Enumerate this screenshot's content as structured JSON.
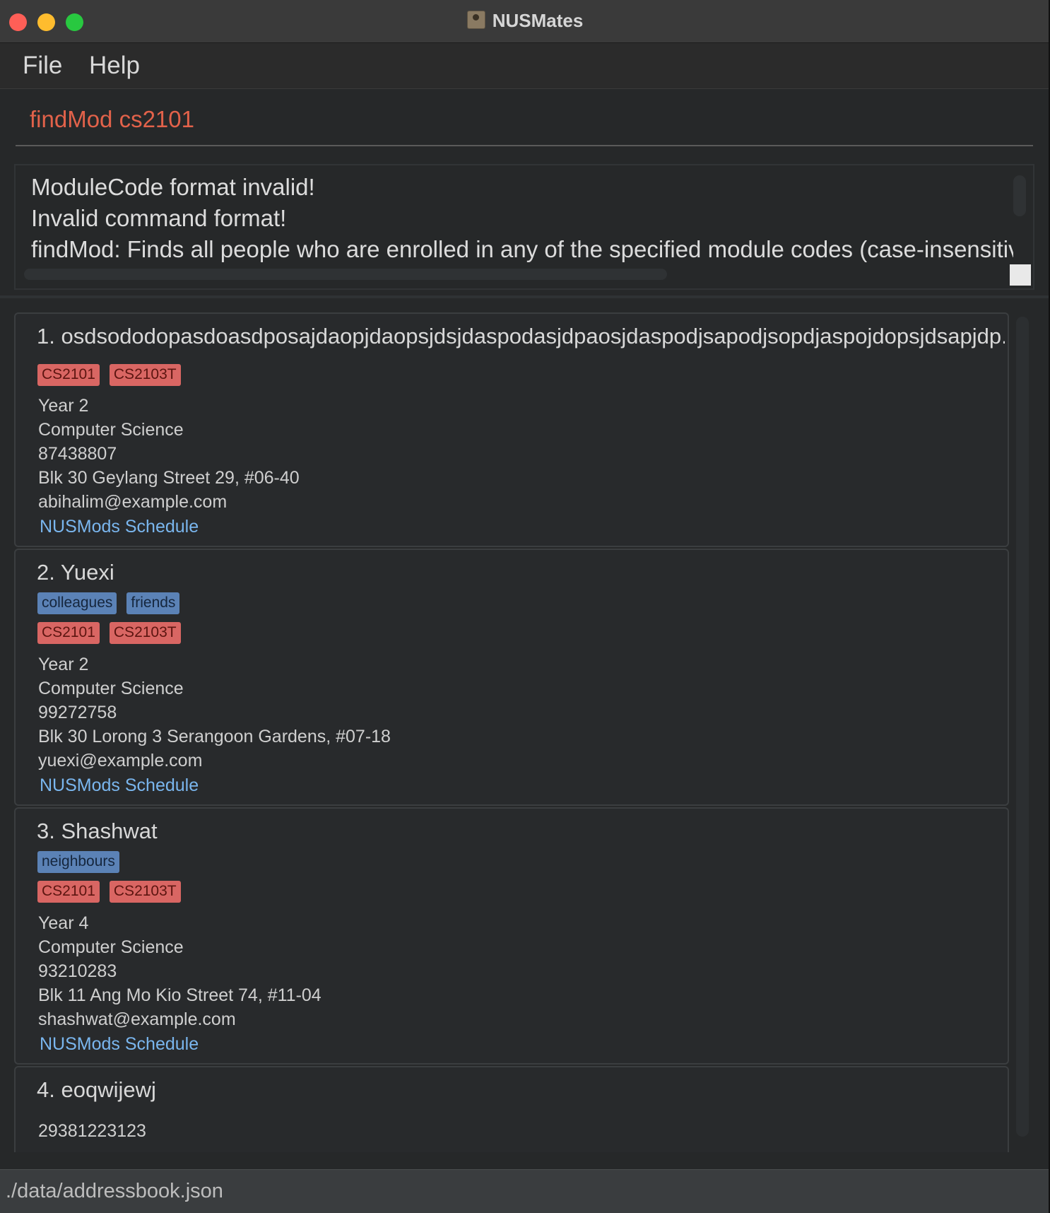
{
  "window": {
    "title": "NUSMates"
  },
  "menu": {
    "file": "File",
    "help": "Help"
  },
  "command": {
    "value": "findMod cs2101"
  },
  "result": {
    "lines": [
      "ModuleCode format invalid!",
      "Invalid command format!",
      "findMod: Finds all people who are enrolled in any of the specified module codes (case-insensitive"
    ]
  },
  "persons": [
    {
      "name": "1. osdsododopasdoasdposajdaopjdaopsjdsjdaspodasjdpaosjdaspodjsapodjsopdjaspojdopsjdsapjdp...",
      "tags": [],
      "modules": [
        "CS2101",
        "CS2103T"
      ],
      "year": "Year 2",
      "major": "Computer Science",
      "phone": "87438807",
      "address": "Blk 30 Geylang Street 29, #06-40",
      "email": "abihalim@example.com",
      "link": "NUSMods Schedule"
    },
    {
      "name": "2. Yuexi",
      "tags": [
        "colleagues",
        "friends"
      ],
      "modules": [
        "CS2101",
        "CS2103T"
      ],
      "year": "Year 2",
      "major": "Computer Science",
      "phone": "99272758",
      "address": "Blk 30 Lorong 3 Serangoon Gardens, #07-18",
      "email": "yuexi@example.com",
      "link": "NUSMods Schedule"
    },
    {
      "name": "3. Shashwat",
      "tags": [
        "neighbours"
      ],
      "modules": [
        "CS2101",
        "CS2103T"
      ],
      "year": "Year 4",
      "major": "Computer Science",
      "phone": "93210283",
      "address": "Blk 11 Ang Mo Kio Street 74, #11-04",
      "email": "shashwat@example.com",
      "link": "NUSMods Schedule"
    },
    {
      "name": "4. eoqwijewj",
      "phone": "29381223123"
    }
  ],
  "status": {
    "path": "./data/addressbook.json"
  },
  "colors": {
    "module_tag": "#d96663",
    "tag": "#5b82b6",
    "command_text": "#e2624a",
    "link": "#7ab6ee"
  }
}
